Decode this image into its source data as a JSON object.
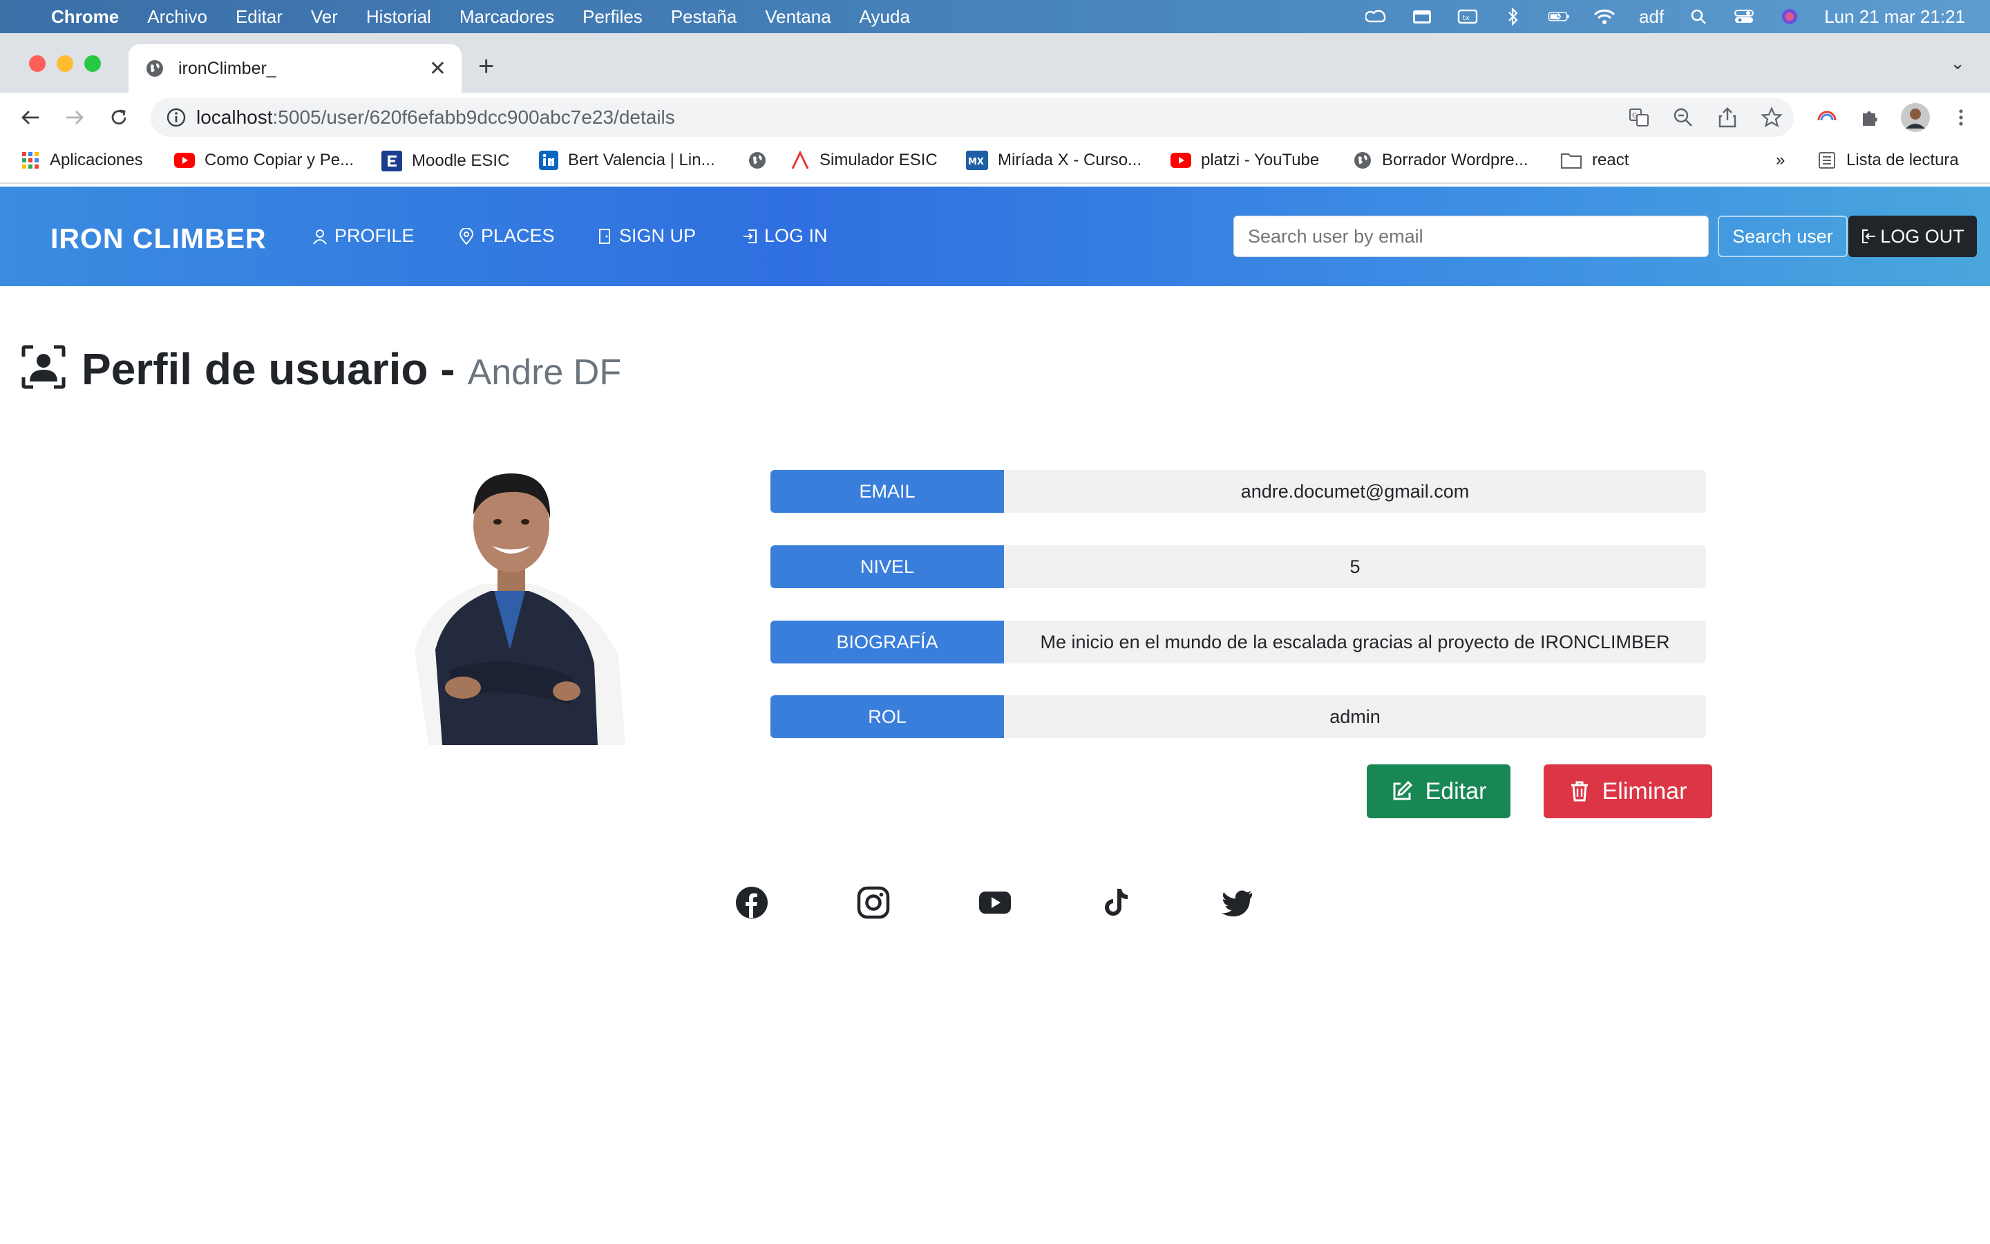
{
  "menubar": {
    "app": "Chrome",
    "items": [
      "Archivo",
      "Editar",
      "Ver",
      "Historial",
      "Marcadores",
      "Perfiles",
      "Pestaña",
      "Ventana",
      "Ayuda"
    ],
    "user": "adf",
    "datetime": "Lun 21 mar  21:21"
  },
  "browser": {
    "tab_title": "ironClimber_",
    "url_host": "localhost",
    "url_path": ":5005/user/620f6efabb9dcc900abc7e23/details",
    "bookmarks": [
      {
        "label": "Aplicaciones",
        "icon": "apps-grid-icon"
      },
      {
        "label": "Como Copiar y Pe...",
        "icon": "youtube-icon"
      },
      {
        "label": "Moodle ESIC",
        "icon": "moodle-icon"
      },
      {
        "label": "Bert Valencia | Lin...",
        "icon": "linkedin-icon"
      },
      {
        "label": "",
        "icon": "globe-icon"
      },
      {
        "label": "Simulador ESIC",
        "icon": "simulador-icon"
      },
      {
        "label": "Miríada X - Curso...",
        "icon": "miriadax-icon"
      },
      {
        "label": "platzi - YouTube",
        "icon": "youtube-icon"
      },
      {
        "label": "Borrador Wordpre...",
        "icon": "globe-icon"
      },
      {
        "label": "react",
        "icon": "folder-icon"
      }
    ],
    "overflow": "»",
    "reading_list": "Lista de lectura"
  },
  "nav": {
    "brand": "IRON CLIMBER",
    "links": [
      "PROFILE",
      "PLACES",
      "SIGN UP",
      "LOG IN"
    ],
    "search_placeholder": "Search user by email",
    "search_button": "Search user",
    "logout": "LOG OUT"
  },
  "profile": {
    "title": "Perfil de usuario -",
    "name": "Andre DF",
    "fields": [
      {
        "label": "EMAIL",
        "value": "andre.documet@gmail.com"
      },
      {
        "label": "NIVEL",
        "value": "5"
      },
      {
        "label": "BIOGRAFÍA",
        "value": "Me inicio en el mundo de la escalada gracias al proyecto de IRONCLIMBER"
      },
      {
        "label": "ROL",
        "value": "admin"
      }
    ],
    "edit_label": "Editar",
    "delete_label": "Eliminar"
  },
  "footer": {
    "social": [
      "facebook-icon",
      "instagram-icon",
      "youtube-icon",
      "tiktok-icon",
      "twitter-icon"
    ]
  },
  "colors": {
    "nav_gradient_start": "#3a8ce0",
    "nav_gradient_end": "#4aa6dc",
    "label_blue": "#3a7edb",
    "edit_green": "#198754",
    "delete_red": "#dc3545"
  }
}
